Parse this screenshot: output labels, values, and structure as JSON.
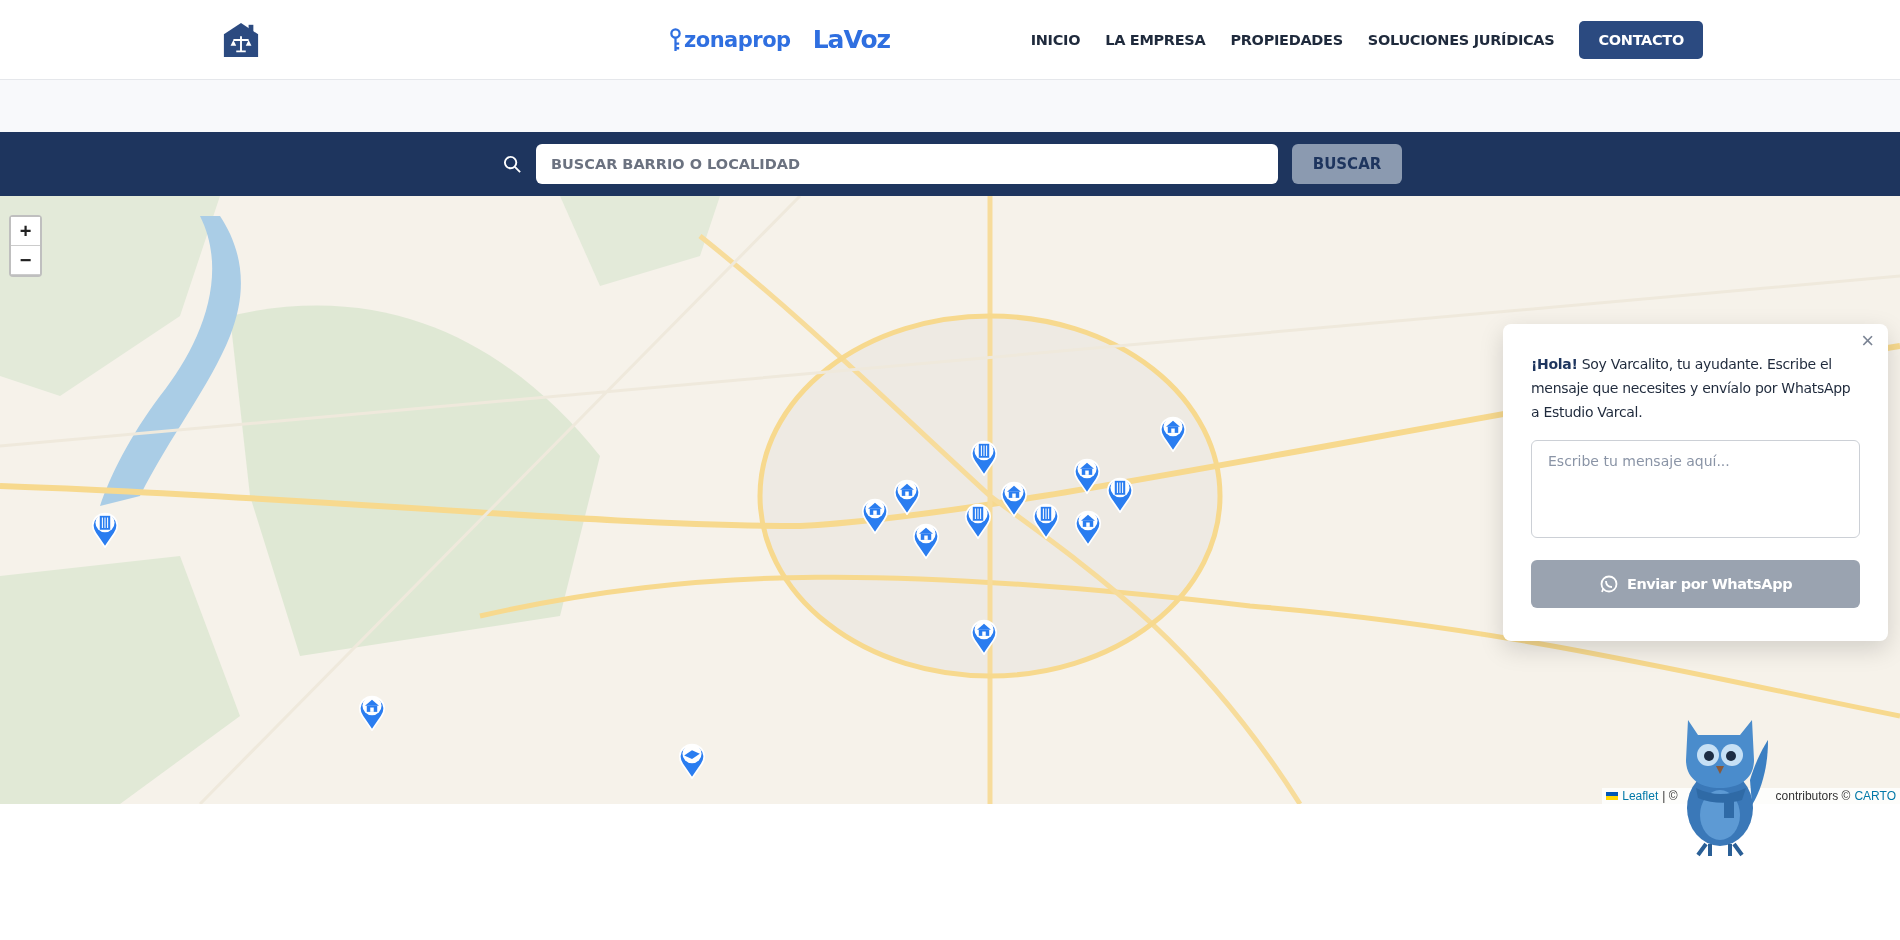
{
  "header": {
    "brands": [
      {
        "kind": "zonaprop",
        "label": "zonaprop"
      },
      {
        "kind": "lavoz",
        "label": "LaVoz"
      }
    ],
    "nav": [
      {
        "label": "INICIO",
        "kind": "link"
      },
      {
        "label": "LA EMPRESA",
        "kind": "link"
      },
      {
        "label": "PROPIEDADES",
        "kind": "link"
      },
      {
        "label": "SOLUCIONES JURÍDICAS",
        "kind": "link"
      },
      {
        "label": "CONTACTO",
        "kind": "button"
      }
    ]
  },
  "search": {
    "placeholder": "BUSCAR BARRIO O LOCALIDAD",
    "button": "BUSCAR"
  },
  "map": {
    "zoom": [
      "+",
      "−"
    ],
    "markers": [
      {
        "kind": "building"
      },
      {
        "kind": "house"
      },
      {
        "kind": "house"
      },
      {
        "kind": "house"
      },
      {
        "kind": "building"
      },
      {
        "kind": "building"
      },
      {
        "kind": "house"
      },
      {
        "kind": "building"
      },
      {
        "kind": "house"
      },
      {
        "kind": "building"
      },
      {
        "kind": "house"
      },
      {
        "kind": "house"
      },
      {
        "kind": "house"
      },
      {
        "kind": "house"
      },
      {
        "kind": "land"
      }
    ],
    "attribution": {
      "leaflet": "Leaflet",
      "sep": "| ©",
      "middle": "contributors ©",
      "carto": "CARTO"
    }
  },
  "chat": {
    "close": "×",
    "text": "**¡Hola!** Soy Varcalito, tu ayudante. Escribe el mensaje que necesites y envíalo por WhatsApp a Estudio Varcal.",
    "placeholder": "Escribe tu mensaje aquí...",
    "send": "Enviar por WhatsApp",
    "send_disabled": true
  }
}
